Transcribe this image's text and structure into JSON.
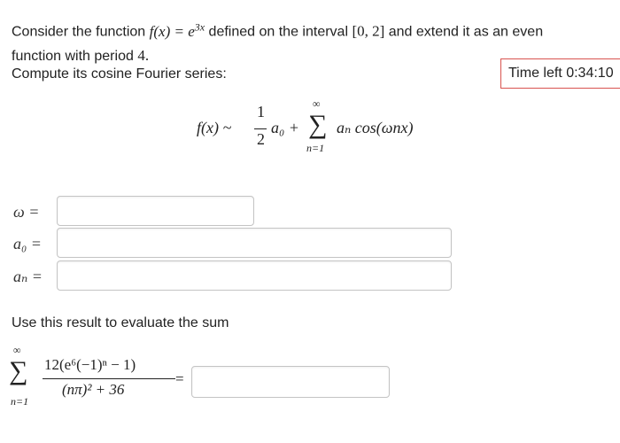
{
  "prompt": {
    "line1_pre": "Consider the function",
    "function_expr": "f(x) = e",
    "exponent": "3x",
    "line1_mid": "defined on the interval",
    "interval": "[0, 2]",
    "line1_post": "and extend it as an even",
    "line2": "function with period",
    "period": "4."
  },
  "compute_label": "Compute its cosine Fourier series:",
  "timer": {
    "label": "Time left",
    "value": "0:34:10"
  },
  "series": {
    "lhs": "f(x) ~",
    "frac_num": "1",
    "frac_den": "2",
    "a0": "a₀ +",
    "sigma": "∑",
    "upper": "∞",
    "lower": "n=1",
    "term": "aₙ cos(ωnx)"
  },
  "fields": {
    "omega_label": "ω =",
    "a0_label": "a₀ =",
    "an_label": "aₙ ="
  },
  "evaluate_label": "Use this result to evaluate the sum",
  "sum": {
    "sigma": "∑",
    "upper": "∞",
    "lower": "n=1",
    "numerator": "12(e⁶(−1)ⁿ − 1)",
    "denominator": "(nπ)² + 36",
    "equals": "="
  }
}
